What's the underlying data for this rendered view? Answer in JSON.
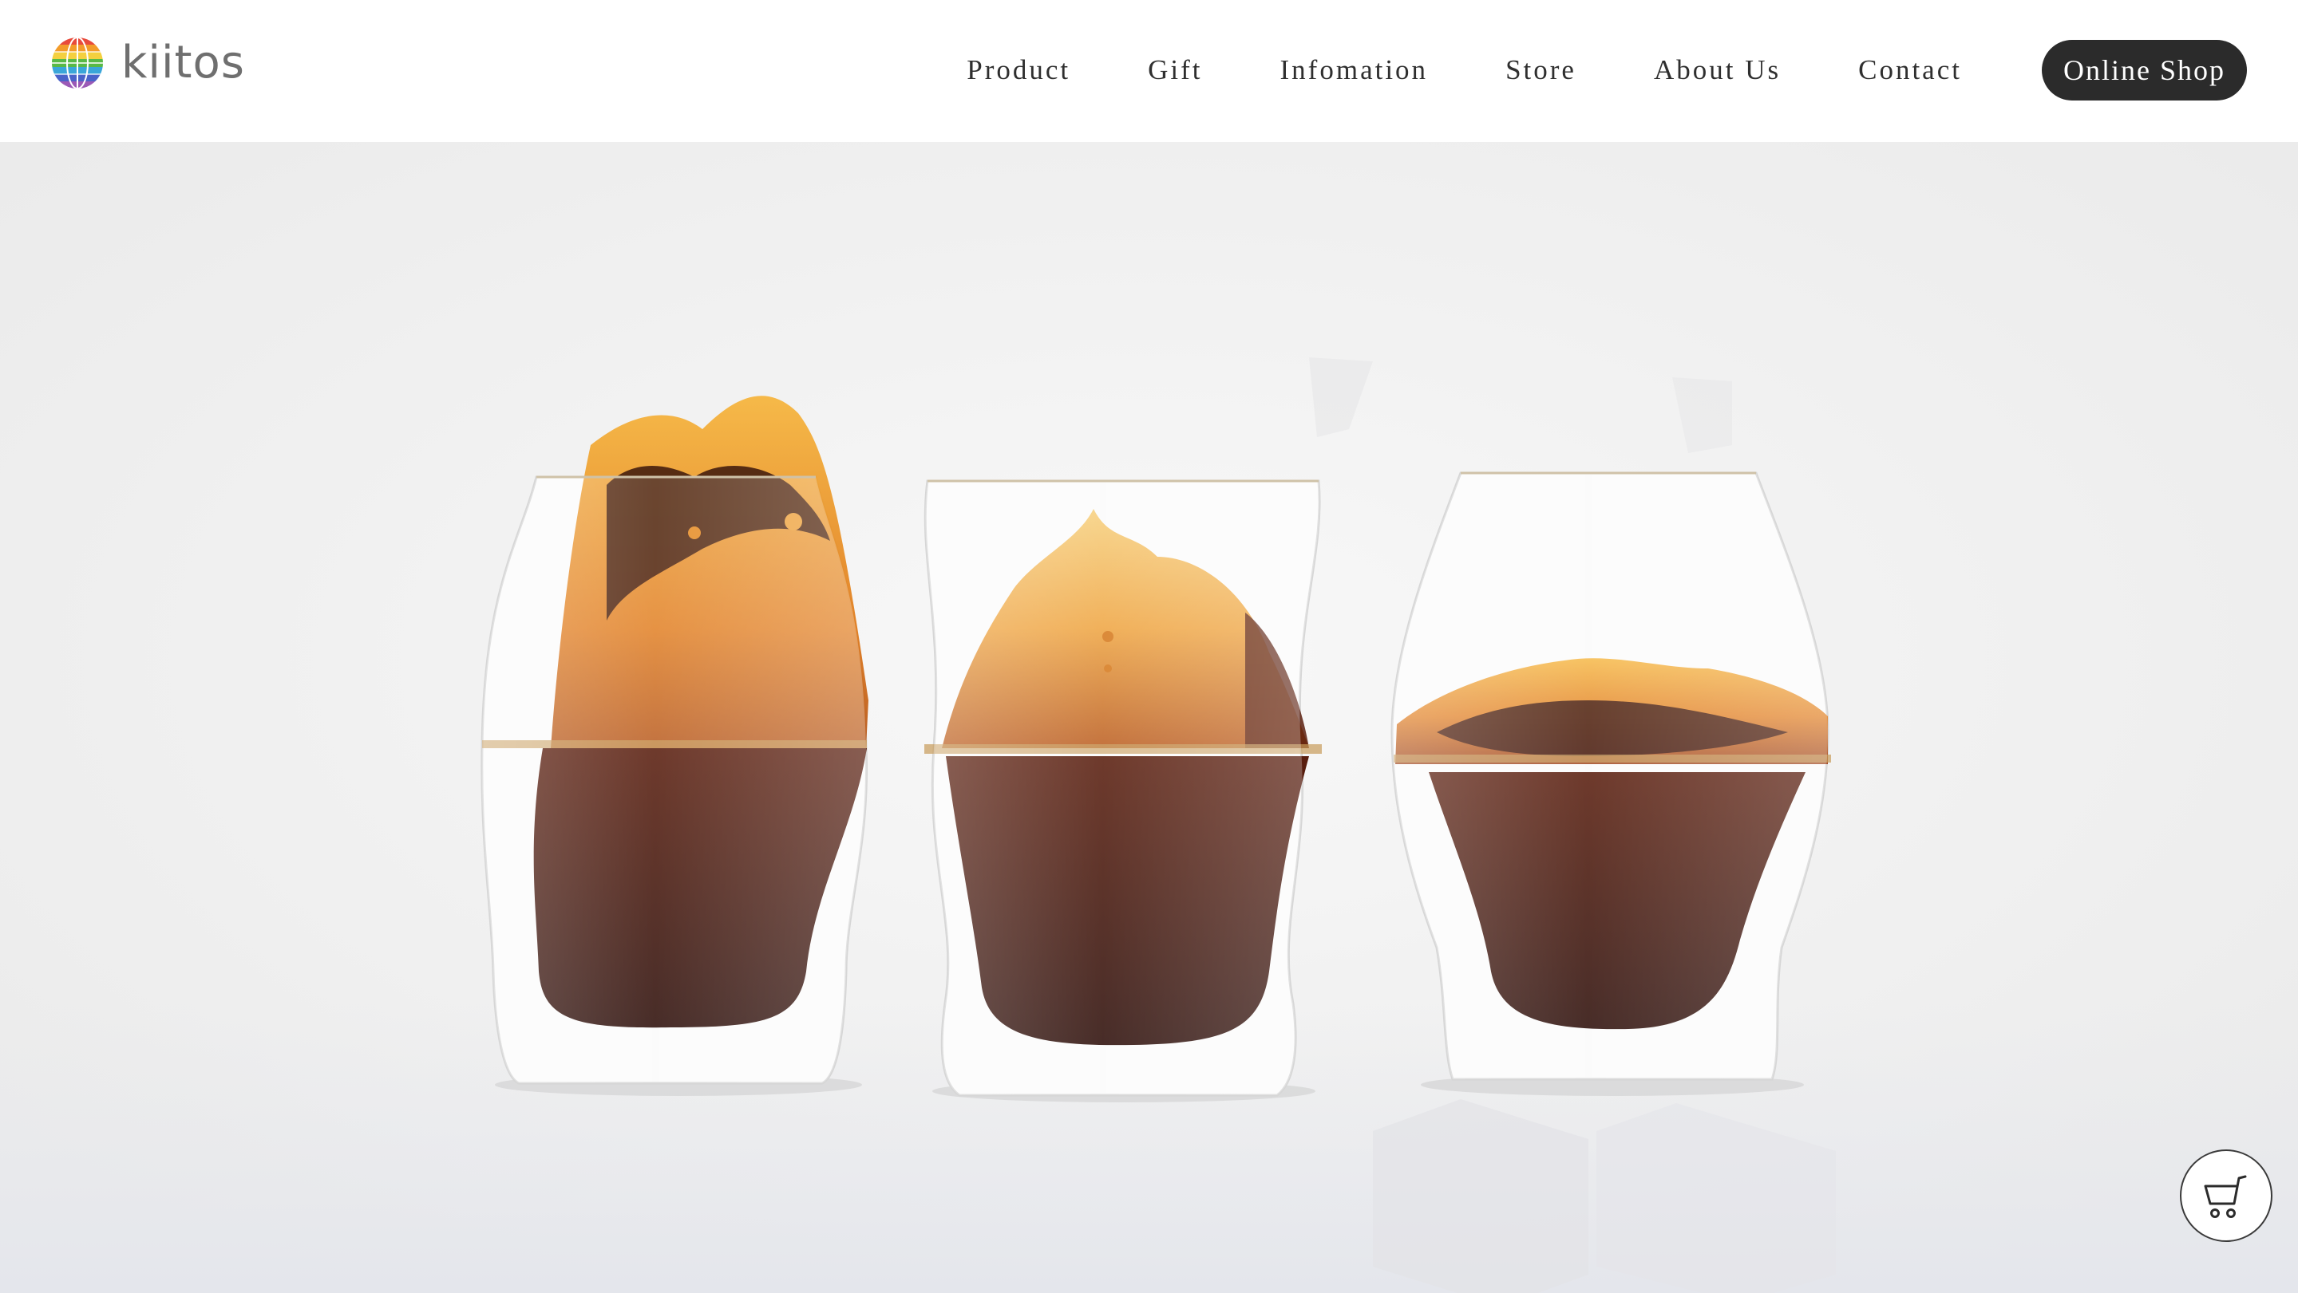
{
  "brand": {
    "name": "kiitos",
    "logo_icon": "rainbow-globe-icon",
    "logo_colors": [
      "#e84b3c",
      "#f39c2a",
      "#f4d03f",
      "#58b947",
      "#3aa6d9",
      "#4a63c9",
      "#9b59b6"
    ]
  },
  "nav": {
    "items": [
      {
        "label": "Product"
      },
      {
        "label": "Gift"
      },
      {
        "label": "Infomation"
      },
      {
        "label": "Store"
      },
      {
        "label": "About Us"
      },
      {
        "label": "Contact"
      }
    ],
    "online_shop_label": "Online Shop"
  },
  "hero": {
    "image_subject": "three-coffee-glasses"
  },
  "cart": {
    "icon": "cart-icon"
  },
  "colors": {
    "button_dark": "#2b2b2b",
    "text_dark": "#2f2f2f",
    "logo_gray": "#6f6f6f",
    "coffee_dark": "#3a140d",
    "coffee_amber": "#e08a1c"
  }
}
